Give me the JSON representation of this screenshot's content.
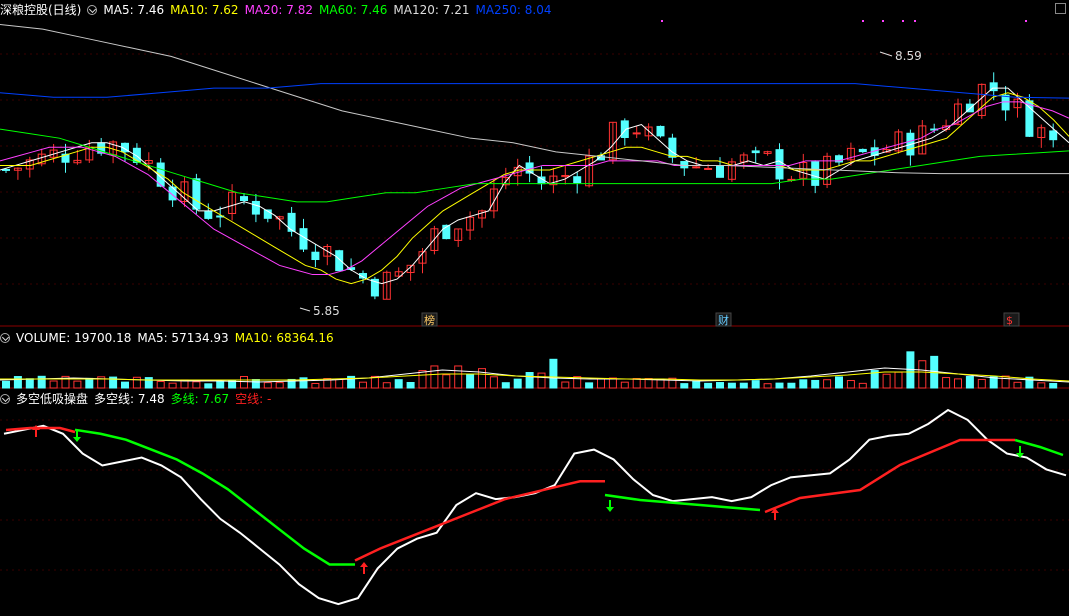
{
  "header": {
    "title": "深粮控股(日线)",
    "ma": [
      {
        "label": "MA5: 7.46",
        "color": "#ffffff"
      },
      {
        "label": "MA10: 7.62",
        "color": "#ffff00"
      },
      {
        "label": "MA20: 7.82",
        "color": "#ff40ff"
      },
      {
        "label": "MA60: 7.46",
        "color": "#00ff00"
      },
      {
        "label": "MA120: 7.21",
        "color": "#dddddd"
      },
      {
        "label": "MA250: 8.04",
        "color": "#0040ff"
      }
    ]
  },
  "volume_header": {
    "label": "VOLUME: 19700.18",
    "ma5": "MA5: 57134.93",
    "ma10": "MA10: 68364.16"
  },
  "indicator_header": {
    "name": "多空低吸操盘",
    "duokong": "多空线: 7.48",
    "duo": "多线: 7.67",
    "kong": "空线: -"
  },
  "annotations": {
    "high": "8.59",
    "low": "5.85",
    "events": [
      {
        "label": "榜",
        "color": "#ffcc66"
      },
      {
        "label": "财",
        "color": "#66ccff"
      },
      {
        "label": "$",
        "color": "#ff3333"
      }
    ]
  },
  "colors": {
    "up": "#ff3232",
    "down": "#54ffff",
    "grid": "#8b0000"
  },
  "chart_data": [
    {
      "type": "candlestick",
      "title": "深粮控股(日线)",
      "ylim": [
        5.6,
        8.9
      ],
      "series": [
        {
          "name": "MA5",
          "values": [
            7.25,
            7.3,
            7.35,
            7.4,
            7.45,
            7.5,
            7.55,
            7.55,
            7.5,
            7.4,
            7.25,
            7.1,
            6.95,
            6.8,
            6.8,
            6.85,
            6.9,
            6.85,
            6.75,
            6.6,
            6.5,
            6.4,
            6.3,
            6.15,
            6.05,
            6.0,
            6.05,
            6.2,
            6.4,
            6.6,
            6.7,
            6.75,
            6.8,
            7.1,
            7.3,
            7.2,
            7.1,
            7.15,
            7.25,
            7.35,
            7.5,
            7.7,
            7.75,
            7.6,
            7.45,
            7.35,
            7.3,
            7.3,
            7.3,
            7.35,
            7.3,
            7.35,
            7.25,
            7.2,
            7.15,
            7.25,
            7.35,
            7.4,
            7.45,
            7.5,
            7.55,
            7.6,
            7.7,
            7.85,
            8.0,
            8.15,
            8.15,
            8.0,
            7.85,
            7.7,
            7.55
          ]
        },
        {
          "name": "MA10",
          "values": [
            7.3,
            7.3,
            7.3,
            7.35,
            7.4,
            7.45,
            7.5,
            7.5,
            7.45,
            7.35,
            7.25,
            7.15,
            7.0,
            6.9,
            6.8,
            6.7,
            6.6,
            6.5,
            6.4,
            6.3,
            6.2,
            6.15,
            6.05,
            6.0,
            6.05,
            6.15,
            6.3,
            6.5,
            6.65,
            6.8,
            6.9,
            7.0,
            7.1,
            7.2,
            7.25,
            7.25,
            7.25,
            7.3,
            7.35,
            7.4,
            7.45,
            7.5,
            7.5,
            7.45,
            7.4,
            7.4,
            7.35,
            7.35,
            7.3,
            7.3,
            7.3,
            7.3,
            7.25,
            7.25,
            7.25,
            7.3,
            7.35,
            7.35,
            7.4,
            7.45,
            7.5,
            7.55,
            7.6,
            7.75,
            7.9,
            8.05,
            8.1,
            8.05,
            7.95,
            7.8,
            7.62
          ]
        },
        {
          "name": "MA20",
          "values": [
            7.35,
            7.4,
            7.45,
            7.5,
            7.5,
            7.5,
            7.45,
            7.4,
            7.3,
            7.2,
            7.05,
            6.9,
            6.75,
            6.6,
            6.5,
            6.4,
            6.3,
            6.2,
            6.15,
            6.1,
            6.1,
            6.15,
            6.25,
            6.4,
            6.55,
            6.7,
            6.85,
            6.95,
            7.05,
            7.1,
            7.15,
            7.2,
            7.25,
            7.3,
            7.3,
            7.3,
            7.3,
            7.35,
            7.35,
            7.35,
            7.35,
            7.3,
            7.3,
            7.3,
            7.3,
            7.3,
            7.3,
            7.3,
            7.3,
            7.35,
            7.35,
            7.35,
            7.4,
            7.45,
            7.5,
            7.55,
            7.6,
            7.7,
            7.75,
            7.85,
            7.95,
            8.0,
            8.0,
            7.95,
            7.9,
            7.82
          ]
        },
        {
          "name": "MA60",
          "values": [
            7.7,
            7.65,
            7.6,
            7.5,
            7.4,
            7.3,
            7.2,
            7.1,
            7.0,
            6.95,
            6.9,
            6.9,
            6.95,
            7.0,
            7.0,
            7.05,
            7.1,
            7.1,
            7.1,
            7.1,
            7.1,
            7.1,
            7.1,
            7.1,
            7.1,
            7.1,
            7.1,
            7.15,
            7.15,
            7.2,
            7.25,
            7.3,
            7.35,
            7.4,
            7.42,
            7.44,
            7.46
          ]
        },
        {
          "name": "MA120",
          "values": [
            8.85,
            8.8,
            8.7,
            8.6,
            8.5,
            8.35,
            8.2,
            8.05,
            7.9,
            7.8,
            7.7,
            7.6,
            7.55,
            7.45,
            7.4,
            7.35,
            7.3,
            7.3,
            7.28,
            7.26,
            7.24,
            7.22,
            7.21,
            7.21,
            7.21,
            7.21
          ]
        },
        {
          "name": "MA250",
          "values": [
            8.1,
            8.05,
            8.05,
            8.1,
            8.15,
            8.15,
            8.2,
            8.2,
            8.2,
            8.2,
            8.2,
            8.2,
            8.2,
            8.2,
            8.2,
            8.2,
            8.2,
            8.15,
            8.1,
            8.05,
            8.04
          ]
        }
      ]
    },
    {
      "type": "bar",
      "title": "VOLUME",
      "series": [
        {
          "name": "VOLUME"
        },
        {
          "name": "MA5"
        },
        {
          "name": "MA10"
        }
      ]
    },
    {
      "type": "line",
      "title": "多空低吸操盘",
      "series": [
        {
          "name": "多空线",
          "values": [
            0.88,
            0.9,
            0.92,
            0.88,
            0.78,
            0.72,
            0.74,
            0.76,
            0.72,
            0.66,
            0.55,
            0.45,
            0.38,
            0.3,
            0.22,
            0.12,
            0.05,
            0.02,
            0.05,
            0.2,
            0.3,
            0.35,
            0.38,
            0.52,
            0.58,
            0.55,
            0.56,
            0.58,
            0.62,
            0.78,
            0.8,
            0.75,
            0.65,
            0.57,
            0.54,
            0.55,
            0.56,
            0.54,
            0.56,
            0.62,
            0.66,
            0.67,
            0.68,
            0.75,
            0.85,
            0.87,
            0.88,
            0.93,
            1.0,
            0.95,
            0.85,
            0.78,
            0.76,
            0.7,
            0.67
          ]
        },
        {
          "name": "多线",
          "values": [
            0.9,
            0.88,
            0.85,
            0.8,
            0.75,
            0.68,
            0.6,
            0.5,
            0.4,
            0.3,
            0.22,
            0.22
          ]
        },
        {
          "name": "空线",
          "values": [
            0.24,
            0.3,
            0.35,
            0.4,
            0.45,
            0.5,
            0.55,
            0.58,
            0.61,
            0.64,
            0.64,
            0.65,
            0.7,
            0.72,
            0.78,
            0.85,
            0.88,
            0.88,
            0.88
          ]
        }
      ]
    }
  ]
}
